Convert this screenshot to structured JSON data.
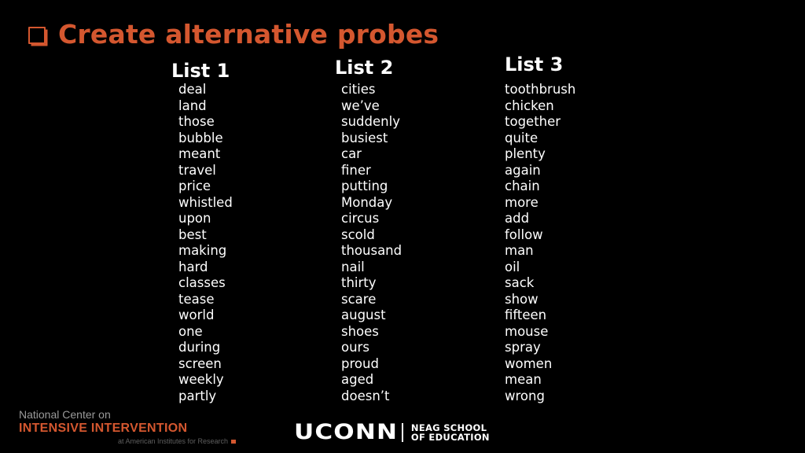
{
  "title": "Create alternative probes",
  "lists": [
    {
      "heading": "List 1",
      "words": [
        "deal",
        "land",
        "those",
        "bubble",
        "meant",
        "travel",
        "price",
        "whistled",
        "upon",
        "best",
        "making",
        "hard",
        "classes",
        "tease",
        "world",
        "one",
        "during",
        "screen",
        "weekly",
        "partly"
      ]
    },
    {
      "heading": "List 2",
      "words": [
        "cities",
        "we’ve",
        "suddenly",
        "busiest",
        "car",
        "finer",
        "putting",
        "Monday",
        "circus",
        "scold",
        "thousand",
        "nail",
        "thirty",
        "scare",
        "august",
        "shoes",
        "ours",
        "proud",
        "aged",
        "doesn’t"
      ]
    },
    {
      "heading": "List 3",
      "words": [
        "toothbrush",
        "chicken",
        "together",
        "quite",
        "plenty",
        "again",
        "chain",
        "more",
        "add",
        "follow",
        "man",
        "oil",
        "sack",
        "show",
        "fifteen",
        "mouse",
        "spray",
        "women",
        "mean",
        "wrong"
      ]
    }
  ],
  "footer": {
    "nci": {
      "line1": "National Center on",
      "line2": "INTENSIVE INTERVENTION",
      "line3": "at American Institutes for Research"
    },
    "uconn": {
      "wordmark": "UCONN",
      "school_line1": "NEAG SCHOOL",
      "school_line2": "OF EDUCATION"
    }
  },
  "colors": {
    "accent": "#d4572f",
    "background": "#000000",
    "text": "#ffffff"
  }
}
